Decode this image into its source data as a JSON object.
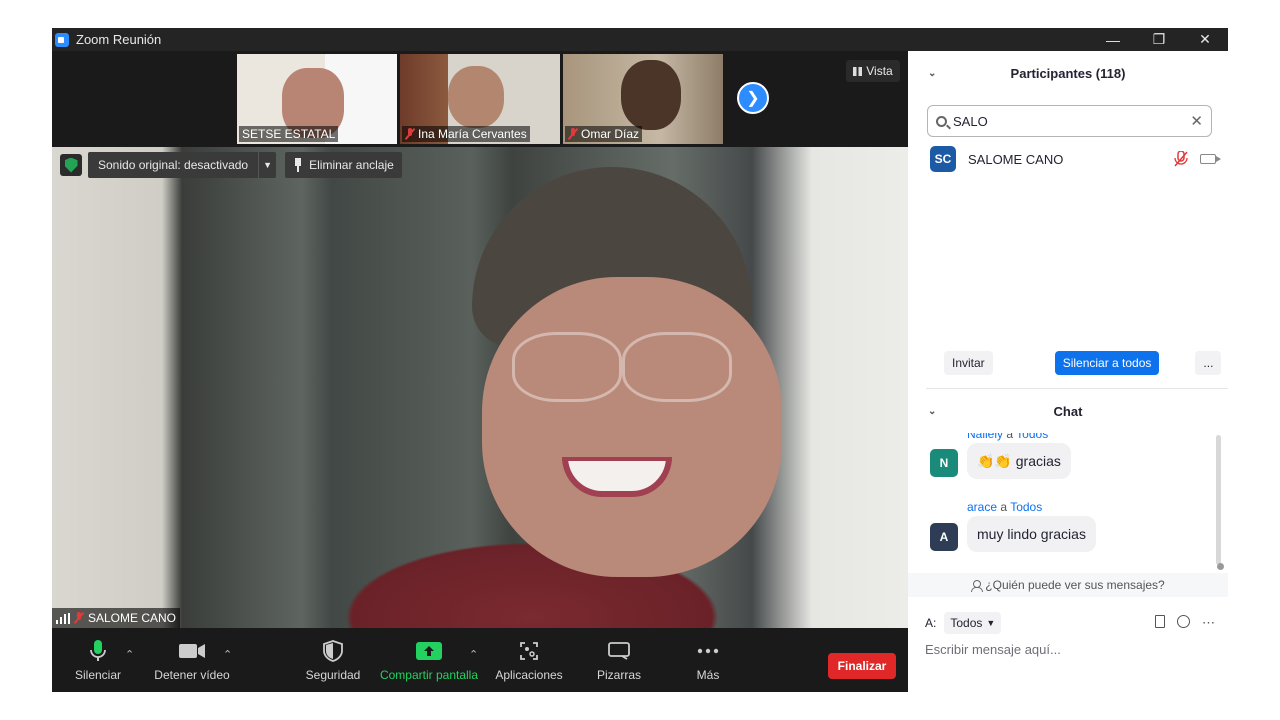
{
  "window": {
    "title": "Zoom Reunión"
  },
  "strip": {
    "thumbnails": [
      {
        "name": "SETSE ESTATAL",
        "muted": false
      },
      {
        "name": "Ina María Cervantes",
        "muted": true
      },
      {
        "name": "Omar Díaz",
        "muted": true
      }
    ],
    "view_label": "Vista"
  },
  "main_video": {
    "audio_label": "Sonido original: desactivado",
    "unpin_label": "Eliminar anclaje",
    "speaker_name": "SALOME CANO"
  },
  "toolbar": {
    "mute_label": "Silenciar",
    "video_label": "Detener vídeo",
    "security_label": "Seguridad",
    "share_label": "Compartir pantalla",
    "apps_label": "Aplicaciones",
    "whiteboards_label": "Pizarras",
    "more_label": "Más",
    "end_label": "Finalizar"
  },
  "participants": {
    "title": "Participantes (118)",
    "search_value": "SALO",
    "list": [
      {
        "initials": "SC",
        "name": "SALOME CANO",
        "avatar_color": "#1c5aa5"
      }
    ],
    "invite_label": "Invitar",
    "mute_all_label": "Silenciar a todos",
    "more_label": "..."
  },
  "chat": {
    "title": "Chat",
    "messages": [
      {
        "initial": "N",
        "sender": "Nallely",
        "to_word": "a",
        "recipient": "Todos",
        "text": "👏👏 gracias",
        "avatar_color": "#1a8a7a"
      },
      {
        "initial": "A",
        "sender": "arace",
        "to_word": "a",
        "recipient": "Todos",
        "text": "muy lindo gracias",
        "avatar_color": "#2e3d55"
      }
    ],
    "visibility_note": "¿Quién puede ver sus mensajes?",
    "to_label": "A:",
    "recipient_select": "Todos",
    "input_placeholder": "Escribir mensaje aquí..."
  },
  "colors": {
    "accent": "#0e72ed",
    "share_green": "#23d160",
    "end_red": "#e02828"
  }
}
